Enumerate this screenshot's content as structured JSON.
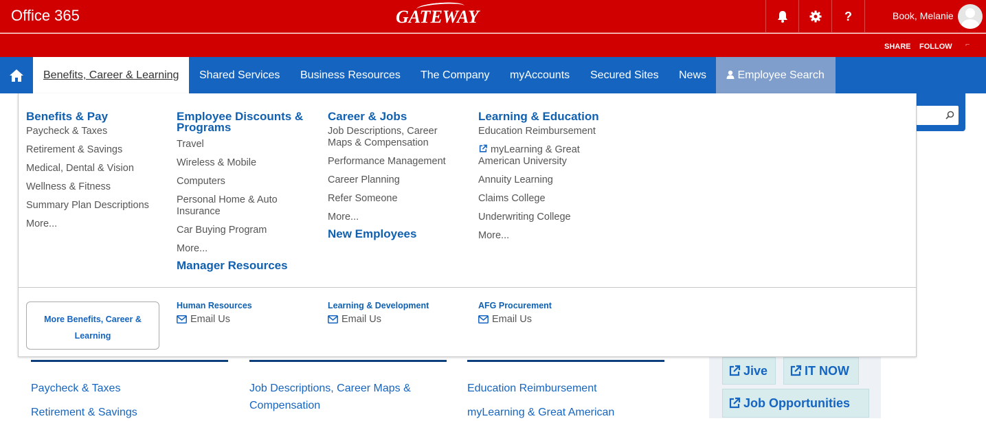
{
  "header": {
    "app_title": "Office 365",
    "logo_text": "GATEWAY",
    "icons": [
      "bell-icon",
      "gear-icon",
      "help-icon"
    ],
    "help_glyph": "?",
    "user_name": "Book, Melanie",
    "brand_color": "#d10000"
  },
  "subbar": {
    "share_label": "SHARE",
    "follow_label": "FOLLOW"
  },
  "nav": {
    "home_icon": "home-icon",
    "items": [
      {
        "label": "Benefits, Career & Learning",
        "active": true
      },
      {
        "label": "Shared Services"
      },
      {
        "label": "Business Resources"
      },
      {
        "label": "The Company"
      },
      {
        "label": "myAccounts"
      },
      {
        "label": "Secured Sites"
      },
      {
        "label": "News"
      },
      {
        "label": "Employee Search",
        "icon": "user-icon"
      }
    ],
    "nav_color": "#1565c0"
  },
  "mega": {
    "columns": [
      {
        "heading": "Benefits & Pay",
        "links": [
          "Paycheck & Taxes",
          "Retirement & Savings",
          "Medical, Dental & Vision",
          "Wellness & Fitness",
          "Summary Plan Descriptions",
          "More..."
        ]
      },
      {
        "heading": "Employee Discounts & Programs",
        "links": [
          "Travel",
          "Wireless & Mobile",
          "Computers",
          "Personal Home & Auto Insurance",
          "Car Buying Program",
          "More..."
        ],
        "sub_heading": "Manager Resources"
      },
      {
        "heading": "Career & Jobs",
        "links": [
          "Job Descriptions, Career Maps & Compensation",
          "Performance Management",
          "Career Planning",
          "Refer Someone",
          "More..."
        ],
        "sub_heading": "New Employees"
      },
      {
        "heading": "Learning & Education",
        "links": [
          "Education Reimbursement",
          "myLearning & Great American University",
          "Annuity Learning",
          "Claims College",
          "Underwriting College",
          "More..."
        ]
      }
    ],
    "more_button": "More Benefits, Career & Learning",
    "contacts": [
      {
        "title": "Human Resources",
        "email_label": "Email Us"
      },
      {
        "title": "Learning & Development",
        "email_label": "Email Us"
      },
      {
        "title": "AFG Procurement",
        "email_label": "Email Us"
      }
    ]
  },
  "page": {
    "columns": [
      {
        "links": [
          "Paycheck & Taxes",
          "Retirement & Savings"
        ]
      },
      {
        "links": [
          "Job Descriptions, Career Maps & Compensation"
        ]
      },
      {
        "links": [
          "Education Reimbursement",
          "myLearning & Great American"
        ]
      }
    ],
    "tiles": [
      "Jive",
      "IT NOW",
      "Job Opportunities"
    ]
  }
}
